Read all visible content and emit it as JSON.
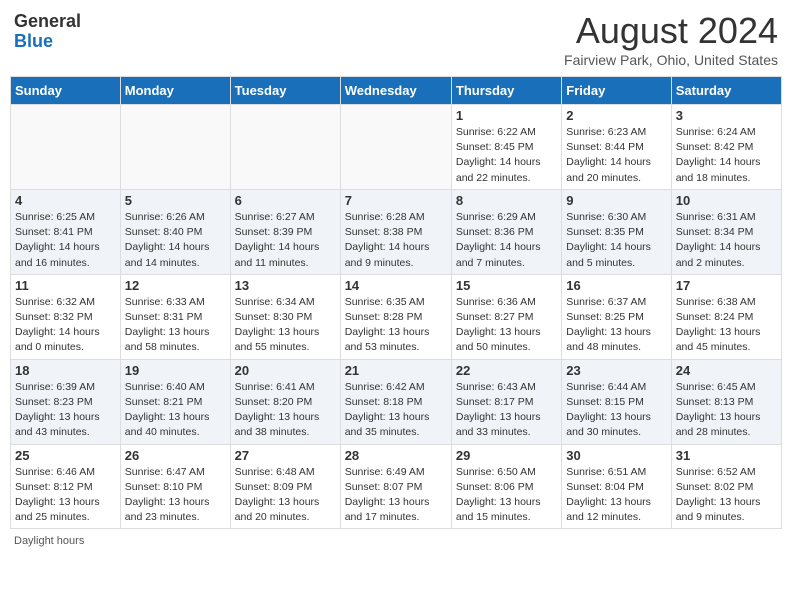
{
  "header": {
    "logo": {
      "general": "General",
      "blue": "Blue"
    },
    "title": "August 2024",
    "location": "Fairview Park, Ohio, United States"
  },
  "calendar": {
    "days_of_week": [
      "Sunday",
      "Monday",
      "Tuesday",
      "Wednesday",
      "Thursday",
      "Friday",
      "Saturday"
    ],
    "weeks": [
      [
        {
          "day": "",
          "sunrise": "",
          "sunset": "",
          "daylight": "",
          "empty": true
        },
        {
          "day": "",
          "sunrise": "",
          "sunset": "",
          "daylight": "",
          "empty": true
        },
        {
          "day": "",
          "sunrise": "",
          "sunset": "",
          "daylight": "",
          "empty": true
        },
        {
          "day": "",
          "sunrise": "",
          "sunset": "",
          "daylight": "",
          "empty": true
        },
        {
          "day": "1",
          "sunrise": "Sunrise: 6:22 AM",
          "sunset": "Sunset: 8:45 PM",
          "daylight": "Daylight: 14 hours and 22 minutes.",
          "empty": false
        },
        {
          "day": "2",
          "sunrise": "Sunrise: 6:23 AM",
          "sunset": "Sunset: 8:44 PM",
          "daylight": "Daylight: 14 hours and 20 minutes.",
          "empty": false
        },
        {
          "day": "3",
          "sunrise": "Sunrise: 6:24 AM",
          "sunset": "Sunset: 8:42 PM",
          "daylight": "Daylight: 14 hours and 18 minutes.",
          "empty": false
        }
      ],
      [
        {
          "day": "4",
          "sunrise": "Sunrise: 6:25 AM",
          "sunset": "Sunset: 8:41 PM",
          "daylight": "Daylight: 14 hours and 16 minutes.",
          "empty": false
        },
        {
          "day": "5",
          "sunrise": "Sunrise: 6:26 AM",
          "sunset": "Sunset: 8:40 PM",
          "daylight": "Daylight: 14 hours and 14 minutes.",
          "empty": false
        },
        {
          "day": "6",
          "sunrise": "Sunrise: 6:27 AM",
          "sunset": "Sunset: 8:39 PM",
          "daylight": "Daylight: 14 hours and 11 minutes.",
          "empty": false
        },
        {
          "day": "7",
          "sunrise": "Sunrise: 6:28 AM",
          "sunset": "Sunset: 8:38 PM",
          "daylight": "Daylight: 14 hours and 9 minutes.",
          "empty": false
        },
        {
          "day": "8",
          "sunrise": "Sunrise: 6:29 AM",
          "sunset": "Sunset: 8:36 PM",
          "daylight": "Daylight: 14 hours and 7 minutes.",
          "empty": false
        },
        {
          "day": "9",
          "sunrise": "Sunrise: 6:30 AM",
          "sunset": "Sunset: 8:35 PM",
          "daylight": "Daylight: 14 hours and 5 minutes.",
          "empty": false
        },
        {
          "day": "10",
          "sunrise": "Sunrise: 6:31 AM",
          "sunset": "Sunset: 8:34 PM",
          "daylight": "Daylight: 14 hours and 2 minutes.",
          "empty": false
        }
      ],
      [
        {
          "day": "11",
          "sunrise": "Sunrise: 6:32 AM",
          "sunset": "Sunset: 8:32 PM",
          "daylight": "Daylight: 14 hours and 0 minutes.",
          "empty": false
        },
        {
          "day": "12",
          "sunrise": "Sunrise: 6:33 AM",
          "sunset": "Sunset: 8:31 PM",
          "daylight": "Daylight: 13 hours and 58 minutes.",
          "empty": false
        },
        {
          "day": "13",
          "sunrise": "Sunrise: 6:34 AM",
          "sunset": "Sunset: 8:30 PM",
          "daylight": "Daylight: 13 hours and 55 minutes.",
          "empty": false
        },
        {
          "day": "14",
          "sunrise": "Sunrise: 6:35 AM",
          "sunset": "Sunset: 8:28 PM",
          "daylight": "Daylight: 13 hours and 53 minutes.",
          "empty": false
        },
        {
          "day": "15",
          "sunrise": "Sunrise: 6:36 AM",
          "sunset": "Sunset: 8:27 PM",
          "daylight": "Daylight: 13 hours and 50 minutes.",
          "empty": false
        },
        {
          "day": "16",
          "sunrise": "Sunrise: 6:37 AM",
          "sunset": "Sunset: 8:25 PM",
          "daylight": "Daylight: 13 hours and 48 minutes.",
          "empty": false
        },
        {
          "day": "17",
          "sunrise": "Sunrise: 6:38 AM",
          "sunset": "Sunset: 8:24 PM",
          "daylight": "Daylight: 13 hours and 45 minutes.",
          "empty": false
        }
      ],
      [
        {
          "day": "18",
          "sunrise": "Sunrise: 6:39 AM",
          "sunset": "Sunset: 8:23 PM",
          "daylight": "Daylight: 13 hours and 43 minutes.",
          "empty": false
        },
        {
          "day": "19",
          "sunrise": "Sunrise: 6:40 AM",
          "sunset": "Sunset: 8:21 PM",
          "daylight": "Daylight: 13 hours and 40 minutes.",
          "empty": false
        },
        {
          "day": "20",
          "sunrise": "Sunrise: 6:41 AM",
          "sunset": "Sunset: 8:20 PM",
          "daylight": "Daylight: 13 hours and 38 minutes.",
          "empty": false
        },
        {
          "day": "21",
          "sunrise": "Sunrise: 6:42 AM",
          "sunset": "Sunset: 8:18 PM",
          "daylight": "Daylight: 13 hours and 35 minutes.",
          "empty": false
        },
        {
          "day": "22",
          "sunrise": "Sunrise: 6:43 AM",
          "sunset": "Sunset: 8:17 PM",
          "daylight": "Daylight: 13 hours and 33 minutes.",
          "empty": false
        },
        {
          "day": "23",
          "sunrise": "Sunrise: 6:44 AM",
          "sunset": "Sunset: 8:15 PM",
          "daylight": "Daylight: 13 hours and 30 minutes.",
          "empty": false
        },
        {
          "day": "24",
          "sunrise": "Sunrise: 6:45 AM",
          "sunset": "Sunset: 8:13 PM",
          "daylight": "Daylight: 13 hours and 28 minutes.",
          "empty": false
        }
      ],
      [
        {
          "day": "25",
          "sunrise": "Sunrise: 6:46 AM",
          "sunset": "Sunset: 8:12 PM",
          "daylight": "Daylight: 13 hours and 25 minutes.",
          "empty": false
        },
        {
          "day": "26",
          "sunrise": "Sunrise: 6:47 AM",
          "sunset": "Sunset: 8:10 PM",
          "daylight": "Daylight: 13 hours and 23 minutes.",
          "empty": false
        },
        {
          "day": "27",
          "sunrise": "Sunrise: 6:48 AM",
          "sunset": "Sunset: 8:09 PM",
          "daylight": "Daylight: 13 hours and 20 minutes.",
          "empty": false
        },
        {
          "day": "28",
          "sunrise": "Sunrise: 6:49 AM",
          "sunset": "Sunset: 8:07 PM",
          "daylight": "Daylight: 13 hours and 17 minutes.",
          "empty": false
        },
        {
          "day": "29",
          "sunrise": "Sunrise: 6:50 AM",
          "sunset": "Sunset: 8:06 PM",
          "daylight": "Daylight: 13 hours and 15 minutes.",
          "empty": false
        },
        {
          "day": "30",
          "sunrise": "Sunrise: 6:51 AM",
          "sunset": "Sunset: 8:04 PM",
          "daylight": "Daylight: 13 hours and 12 minutes.",
          "empty": false
        },
        {
          "day": "31",
          "sunrise": "Sunrise: 6:52 AM",
          "sunset": "Sunset: 8:02 PM",
          "daylight": "Daylight: 13 hours and 9 minutes.",
          "empty": false
        }
      ]
    ]
  },
  "footer": {
    "text": "Daylight hours"
  }
}
